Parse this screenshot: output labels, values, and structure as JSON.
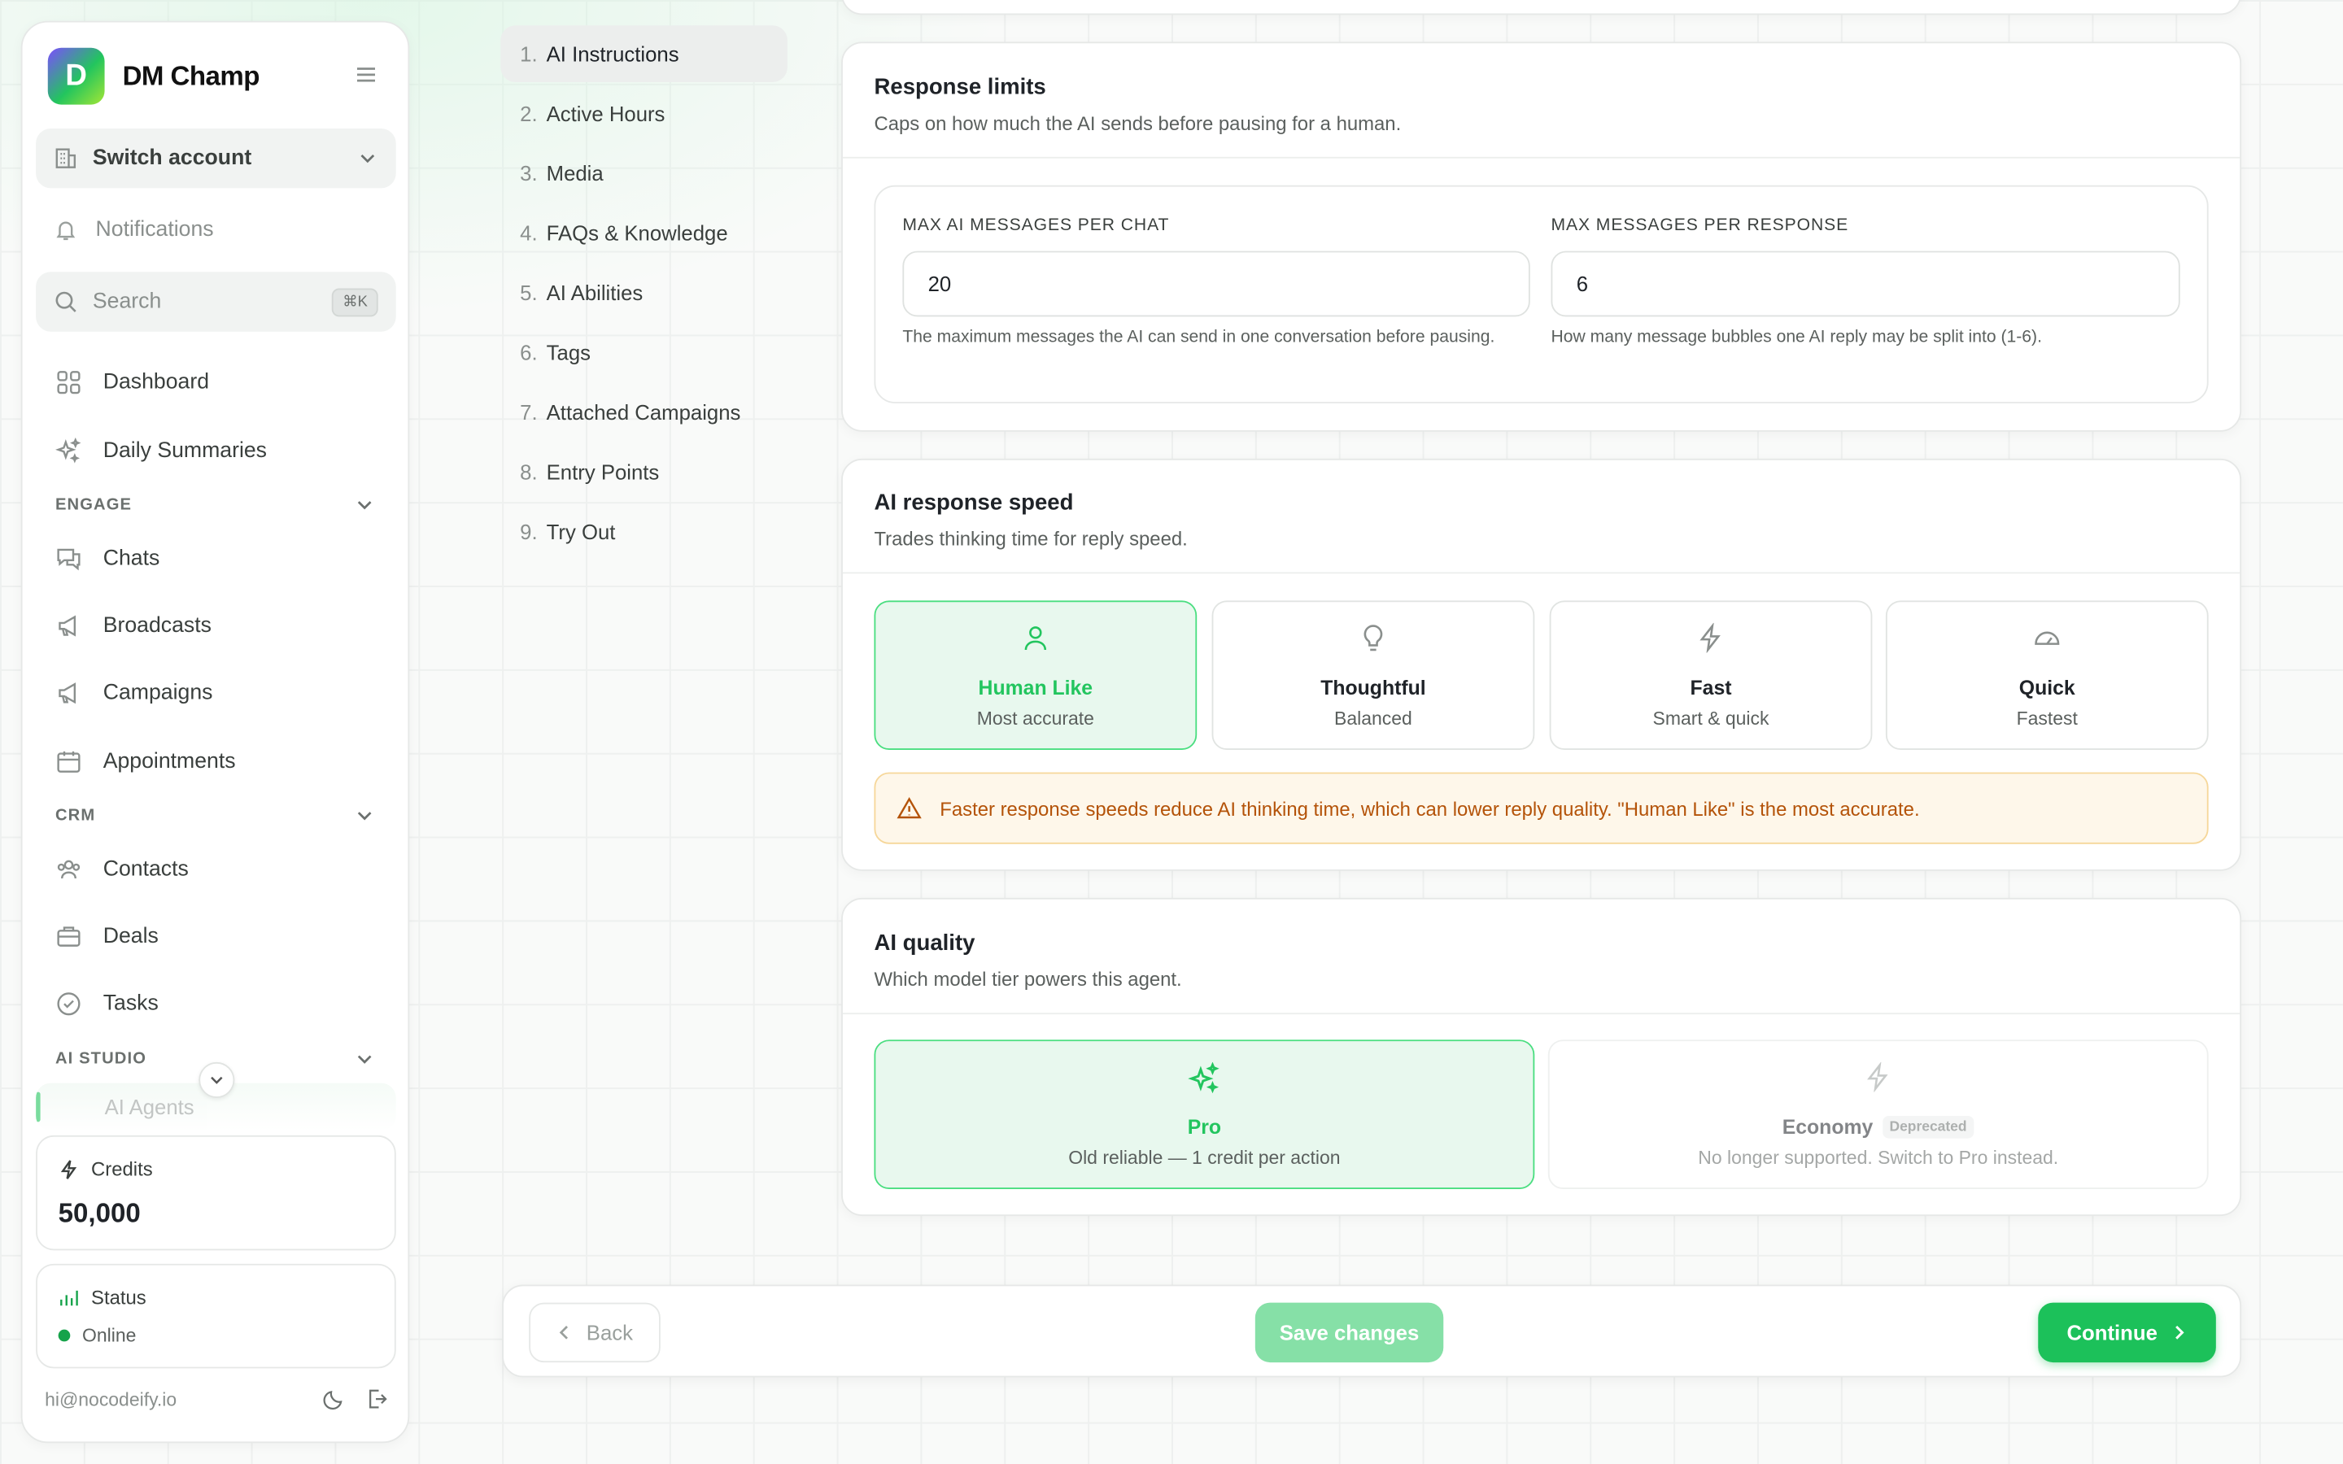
{
  "brand": {
    "name": "DM Champ",
    "logo_letter": "D"
  },
  "sidebar": {
    "switch_account": "Switch account",
    "notifications": "Notifications",
    "search": {
      "placeholder": "Search",
      "shortcut": "⌘K"
    },
    "items_top": [
      {
        "label": "Dashboard",
        "icon": "grid-icon"
      },
      {
        "label": "Daily Summaries",
        "icon": "sparkles-icon"
      }
    ],
    "sections": [
      {
        "title": "ENGAGE",
        "items": [
          "Chats",
          "Broadcasts",
          "Campaigns",
          "Appointments"
        ]
      },
      {
        "title": "CRM",
        "items": [
          "Contacts",
          "Deals",
          "Tasks"
        ]
      },
      {
        "title": "AI STUDIO",
        "items": [
          "AI Agents"
        ]
      }
    ],
    "credits": {
      "label": "Credits",
      "value": "50,000"
    },
    "status": {
      "label": "Status",
      "value": "Online",
      "color": "#16a34a"
    },
    "email": "hi@nocodeify.io"
  },
  "steps": [
    {
      "num": "1.",
      "label": "AI Instructions",
      "active": true
    },
    {
      "num": "2.",
      "label": "Active Hours"
    },
    {
      "num": "3.",
      "label": "Media"
    },
    {
      "num": "4.",
      "label": "FAQs & Knowledge"
    },
    {
      "num": "5.",
      "label": "AI Abilities"
    },
    {
      "num": "6.",
      "label": "Tags"
    },
    {
      "num": "7.",
      "label": "Attached Campaigns"
    },
    {
      "num": "8.",
      "label": "Entry Points"
    },
    {
      "num": "9.",
      "label": "Try Out"
    }
  ],
  "response_limits": {
    "title": "Response limits",
    "subtitle": "Caps on how much the AI sends before pausing for a human.",
    "max_chat": {
      "label": "MAX AI MESSAGES PER CHAT",
      "value": "20",
      "help": "The maximum messages the AI can send in one conversation before pausing."
    },
    "max_response": {
      "label": "MAX MESSAGES PER RESPONSE",
      "value": "6",
      "help": "How many message bubbles one AI reply may be split into (1-6)."
    }
  },
  "speed": {
    "title": "AI response speed",
    "subtitle": "Trades thinking time for reply speed.",
    "options": [
      {
        "name": "Human Like",
        "desc": "Most accurate",
        "icon": "user-icon",
        "selected": true
      },
      {
        "name": "Thoughtful",
        "desc": "Balanced",
        "icon": "lightbulb-icon"
      },
      {
        "name": "Fast",
        "desc": "Smart & quick",
        "icon": "bolt-icon"
      },
      {
        "name": "Quick",
        "desc": "Fastest",
        "icon": "gauge-icon"
      }
    ],
    "warning": "Faster response speeds reduce AI thinking time, which can lower reply quality. \"Human Like\" is the most accurate."
  },
  "quality": {
    "title": "AI quality",
    "subtitle": "Which model tier powers this agent.",
    "options": [
      {
        "name": "Pro",
        "desc": "Old reliable — 1 credit per action",
        "icon": "sparkles-icon",
        "selected": true
      },
      {
        "name": "Economy",
        "badge": "Deprecated",
        "desc": "No longer supported. Switch to Pro instead.",
        "icon": "bolt-icon"
      }
    ]
  },
  "footer": {
    "back": "Back",
    "save": "Save changes",
    "continue": "Continue"
  },
  "colors": {
    "accent": "#22c55e",
    "warning": "#b45309"
  }
}
